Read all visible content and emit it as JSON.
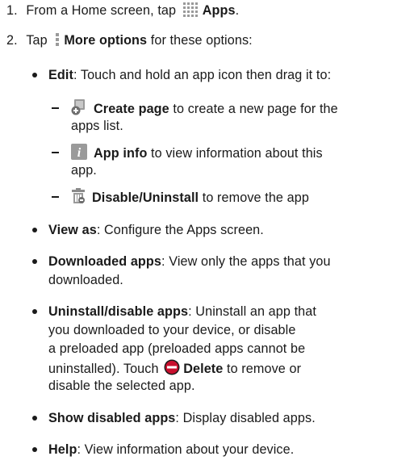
{
  "steps": [
    {
      "number": "1.",
      "text_before": "From a Home screen, tap",
      "bold": "Apps",
      "text_after": ".",
      "icon": "apps-grid-icon"
    },
    {
      "number": "2.",
      "text_before": "Tap",
      "bold": "More options",
      "text_after": "for these options:",
      "icon": "more-options-icon"
    }
  ],
  "edit": {
    "bold": "Edit",
    "text": ": Touch and hold an app icon then drag it to:",
    "sub_items": [
      {
        "icon": "create-page-icon",
        "bold": "Create page",
        "line1": "to create a new page for the",
        "line2": "apps list."
      },
      {
        "icon": "app-info-icon",
        "bold": "App info",
        "line1": "to view information about this",
        "line2": "app."
      },
      {
        "icon": "disable-uninstall-icon",
        "bold": "Disable/Uninstall",
        "line1": "to remove the app"
      }
    ]
  },
  "view_as": {
    "bold": "View as",
    "text": ": Configure the Apps screen."
  },
  "downloaded_apps": {
    "bold": "Downloaded apps",
    "line1": ": View only the apps that you",
    "line2": "downloaded."
  },
  "uninstall_disable": {
    "bold": "Uninstall/disable apps",
    "line1": ": Uninstall an app that",
    "line2": "you downloaded to your device, or disable",
    "line3": "a preloaded app (preloaded apps cannot be",
    "line4_before": "uninstalled). Touch",
    "line4_bold": "Delete",
    "line4_after": "to remove or",
    "line5": "disable the selected app.",
    "icon": "delete-icon"
  },
  "show_disabled": {
    "bold": "Show disabled apps",
    "text": ": Display disabled apps."
  },
  "help": {
    "bold": "Help",
    "text": ": View information about your device."
  }
}
